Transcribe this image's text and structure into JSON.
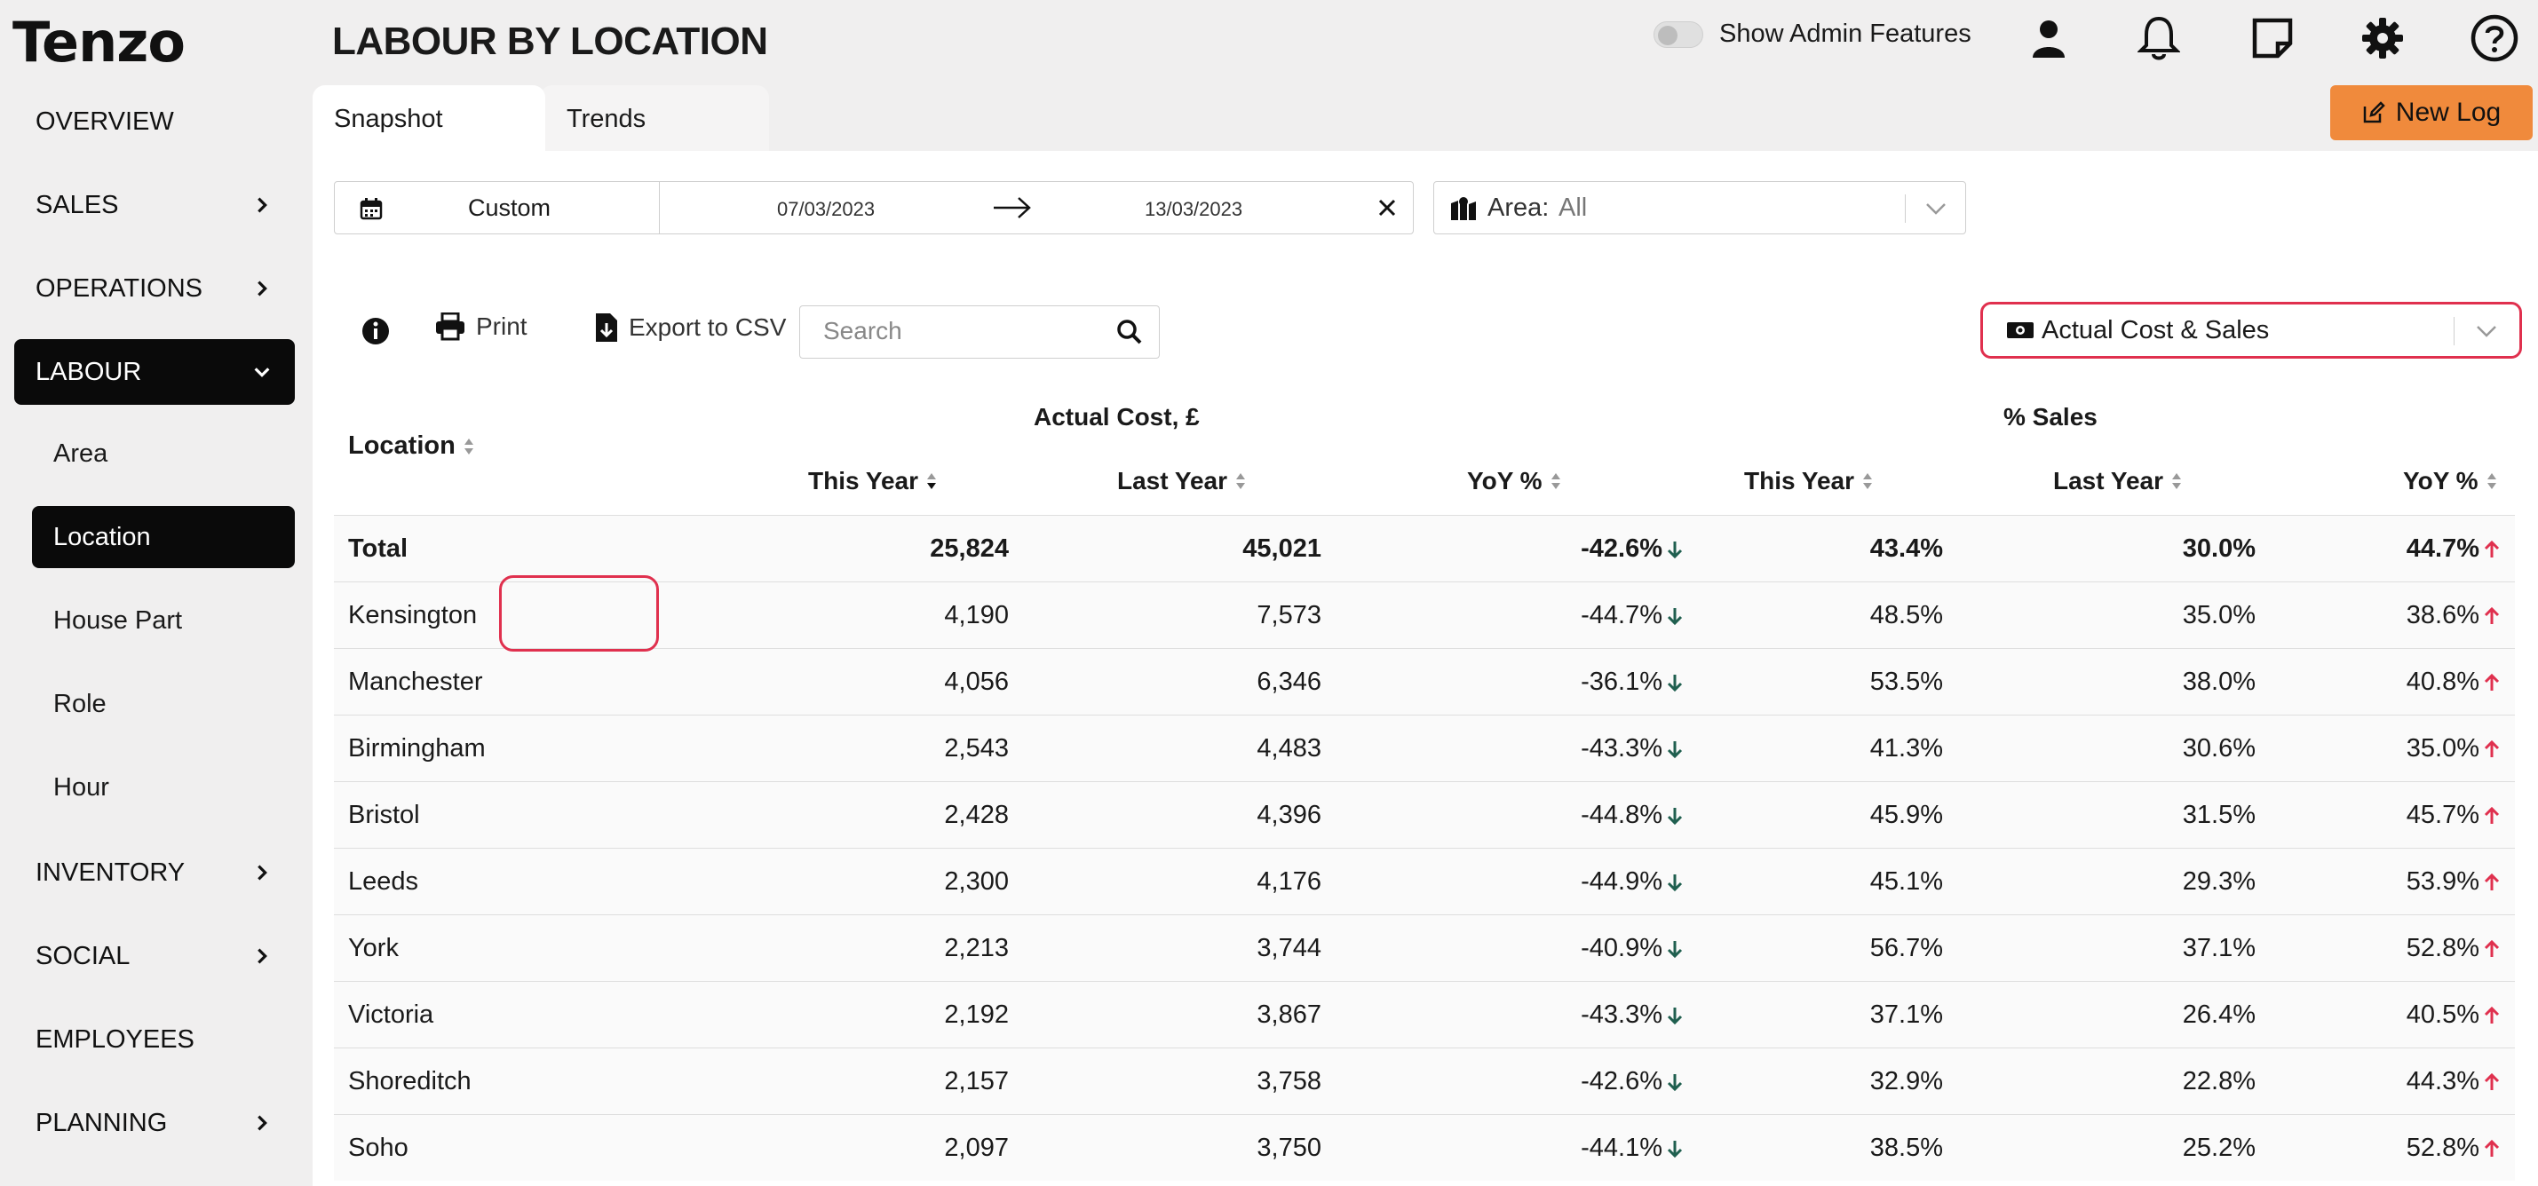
{
  "app": {
    "logo": "Tenzo",
    "page_title": "LABOUR BY LOCATION"
  },
  "header": {
    "admin_toggle_label": "Show Admin Features"
  },
  "sidebar": {
    "items": [
      {
        "label": "OVERVIEW"
      },
      {
        "label": "SALES"
      },
      {
        "label": "OPERATIONS"
      },
      {
        "label": "LABOUR"
      },
      {
        "label": "INVENTORY"
      },
      {
        "label": "SOCIAL"
      },
      {
        "label": "EMPLOYEES"
      },
      {
        "label": "PLANNING"
      }
    ],
    "labour_sub": [
      {
        "label": "Area"
      },
      {
        "label": "Location"
      },
      {
        "label": "House Part"
      },
      {
        "label": "Role"
      },
      {
        "label": "Hour"
      }
    ]
  },
  "tabs": [
    {
      "label": "Snapshot"
    },
    {
      "label": "Trends"
    }
  ],
  "new_log_label": "New Log",
  "filters": {
    "date_mode": "Custom",
    "date_start": "07/03/2023",
    "date_end": "13/03/2023",
    "area_label": "Area:",
    "area_value": "All"
  },
  "toolbar": {
    "print_label": "Print",
    "export_label": "Export to CSV",
    "search_placeholder": "Search",
    "metric_value": "Actual Cost & Sales"
  },
  "table": {
    "location_header": "Location",
    "group_cost": "Actual Cost, £",
    "group_sales": "% Sales",
    "col_this_year": "This Year",
    "col_last_year": "Last Year",
    "col_yoy": "YoY %",
    "rows": [
      {
        "location": "Total",
        "cost_ty": "25,824",
        "cost_ly": "45,021",
        "cost_yoy": "-42.6%",
        "sales_ty": "43.4%",
        "sales_ly": "30.0%",
        "sales_yoy": "44.7%"
      },
      {
        "location": "Kensington",
        "cost_ty": "4,190",
        "cost_ly": "7,573",
        "cost_yoy": "-44.7%",
        "sales_ty": "48.5%",
        "sales_ly": "35.0%",
        "sales_yoy": "38.6%"
      },
      {
        "location": "Manchester",
        "cost_ty": "4,056",
        "cost_ly": "6,346",
        "cost_yoy": "-36.1%",
        "sales_ty": "53.5%",
        "sales_ly": "38.0%",
        "sales_yoy": "40.8%"
      },
      {
        "location": "Birmingham",
        "cost_ty": "2,543",
        "cost_ly": "4,483",
        "cost_yoy": "-43.3%",
        "sales_ty": "41.3%",
        "sales_ly": "30.6%",
        "sales_yoy": "35.0%"
      },
      {
        "location": "Bristol",
        "cost_ty": "2,428",
        "cost_ly": "4,396",
        "cost_yoy": "-44.8%",
        "sales_ty": "45.9%",
        "sales_ly": "31.5%",
        "sales_yoy": "45.7%"
      },
      {
        "location": "Leeds",
        "cost_ty": "2,300",
        "cost_ly": "4,176",
        "cost_yoy": "-44.9%",
        "sales_ty": "45.1%",
        "sales_ly": "29.3%",
        "sales_yoy": "53.9%"
      },
      {
        "location": "York",
        "cost_ty": "2,213",
        "cost_ly": "3,744",
        "cost_yoy": "-40.9%",
        "sales_ty": "56.7%",
        "sales_ly": "37.1%",
        "sales_yoy": "52.8%"
      },
      {
        "location": "Victoria",
        "cost_ty": "2,192",
        "cost_ly": "3,867",
        "cost_yoy": "-43.3%",
        "sales_ty": "37.1%",
        "sales_ly": "26.4%",
        "sales_yoy": "40.5%"
      },
      {
        "location": "Shoreditch",
        "cost_ty": "2,157",
        "cost_ly": "3,758",
        "cost_yoy": "-42.6%",
        "sales_ty": "32.9%",
        "sales_ly": "22.8%",
        "sales_yoy": "44.3%"
      },
      {
        "location": "Soho",
        "cost_ty": "2,097",
        "cost_ly": "3,750",
        "cost_yoy": "-44.1%",
        "sales_ty": "38.5%",
        "sales_ly": "25.2%",
        "sales_yoy": "52.8%"
      }
    ]
  },
  "colors": {
    "accent_orange": "#f08a3c",
    "highlight_red": "#e0304e",
    "down_arrow": "#1f5f4f",
    "up_arrow": "#e0304e"
  }
}
